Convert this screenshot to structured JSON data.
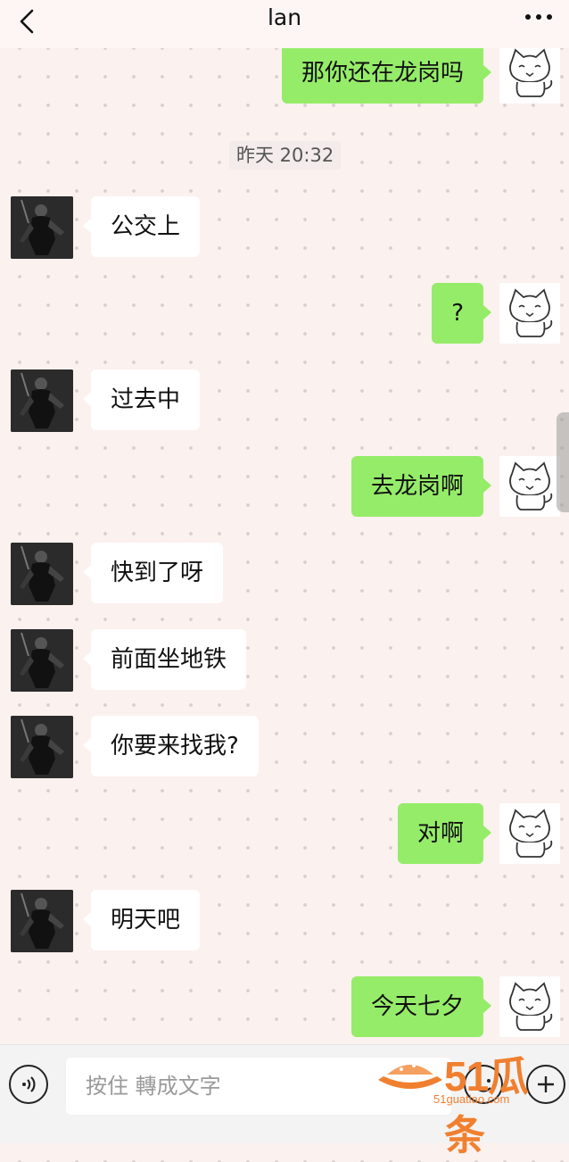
{
  "header": {
    "title": "lan",
    "back_icon": "chevron-left-icon",
    "more_icon": "more-icon"
  },
  "timestamp": "昨天 20:32",
  "messages": [
    {
      "side": "out",
      "text": "那你还在龙岗吗"
    },
    {
      "side": "in",
      "text": "公交上"
    },
    {
      "side": "out",
      "text": "?"
    },
    {
      "side": "in",
      "text": "过去中"
    },
    {
      "side": "out",
      "text": "去龙岗啊"
    },
    {
      "side": "in",
      "text": "快到了呀"
    },
    {
      "side": "in",
      "text": "前面坐地铁"
    },
    {
      "side": "in",
      "text": "你要来找我?"
    },
    {
      "side": "out",
      "text": "对啊"
    },
    {
      "side": "in",
      "text": "明天吧"
    },
    {
      "side": "out",
      "text": "今天七夕"
    }
  ],
  "input_bar": {
    "placeholder": "按住 轉成文字",
    "voice_icon": "voice-icon",
    "emoji_icon": "emoji-icon",
    "plus_icon": "plus-icon"
  },
  "watermark": {
    "text": "51瓜条",
    "sub": "51guatiao.com"
  },
  "colors": {
    "outgoing_bubble": "#95ec69",
    "incoming_bubble": "#ffffff",
    "background": "#fbf1ee"
  }
}
